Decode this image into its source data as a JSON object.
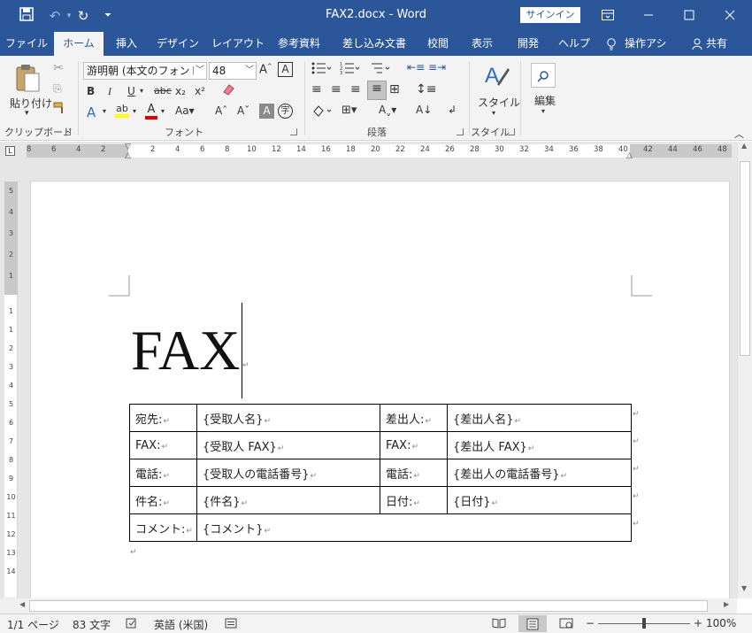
{
  "title_bar": {
    "doc_title": "FAX2.docx  -  Word",
    "signin": "サインイン",
    "icons": [
      "save-icon",
      "undo-icon",
      "redo-icon",
      "customize-icon",
      "ribbon-display-icon",
      "minimize-icon",
      "maximize-icon",
      "close-icon"
    ]
  },
  "tabs": [
    {
      "label": "ファイル"
    },
    {
      "label": "ホーム",
      "active": true
    },
    {
      "label": "挿入"
    },
    {
      "label": "デザイン"
    },
    {
      "label": "レイアウト"
    },
    {
      "label": "参考資料"
    },
    {
      "label": "差し込み文書"
    },
    {
      "label": "校閲"
    },
    {
      "label": "表示"
    },
    {
      "label": "開発"
    },
    {
      "label": "ヘルプ"
    },
    {
      "label": "操作アシ"
    },
    {
      "label": "共有"
    }
  ],
  "ribbon": {
    "paste_label": "貼り付け",
    "font_name": "游明朝 (本文のフォント)",
    "font_size": "48",
    "style_label": "スタイル",
    "edit_label": "編集",
    "groups": {
      "clipboard": "クリップボード",
      "font": "フォント",
      "paragraph": "段落",
      "style": "スタイル"
    },
    "format_buttons": [
      "B",
      "I",
      "U",
      "abc",
      "x₂",
      "x²"
    ]
  },
  "ruler": {
    "h_numbers_left": [
      "8",
      "6",
      "4",
      "2"
    ],
    "h_numbers_right": [
      "2",
      "4",
      "6",
      "8",
      "10",
      "12",
      "14",
      "16",
      "18",
      "20",
      "22",
      "24",
      "26",
      "28",
      "30",
      "32",
      "34",
      "36",
      "38",
      "40",
      "42",
      "44",
      "46",
      "48"
    ],
    "v_numbers": [
      "5",
      "4",
      "3",
      "2",
      "1",
      "1",
      "1",
      "2",
      "3",
      "4",
      "5",
      "6",
      "7",
      "8",
      "9",
      "10",
      "11",
      "12",
      "13",
      "14"
    ]
  },
  "document": {
    "heading": "FAX",
    "table": [
      [
        "宛先:",
        "{受取人名}",
        "差出人:",
        "{差出人名}"
      ],
      [
        "FAX:",
        "{受取人 FAX}",
        "FAX:",
        "{差出人 FAX}"
      ],
      [
        "電話:",
        "{受取人の電話番号}",
        "電話:",
        "{差出人の電話番号}"
      ],
      [
        "件名:",
        "{件名}",
        "日付:",
        "{日付}"
      ],
      [
        "コメント:",
        "{コメント}"
      ]
    ],
    "paragraph_mark": "↵"
  },
  "status": {
    "page": "1/1 ページ",
    "words": "83 文字",
    "language": "英語 (米国)",
    "zoom": "100%",
    "zoom_level_percent": 100
  }
}
